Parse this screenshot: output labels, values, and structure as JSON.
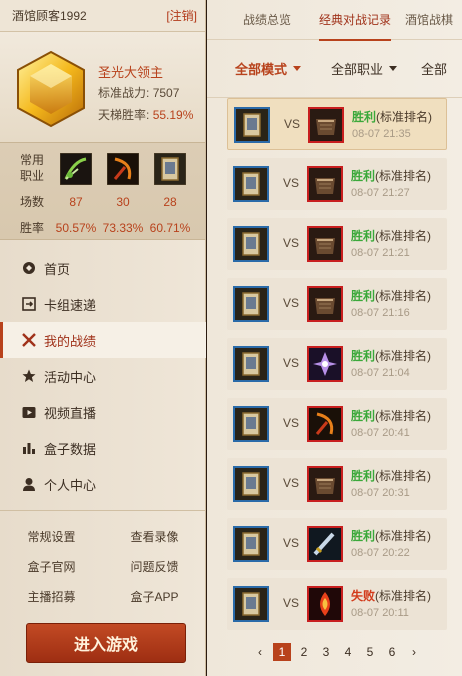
{
  "account": {
    "username": "酒馆顾客1992",
    "logout": "[注销]"
  },
  "profile": {
    "rank_name": "圣光大领主",
    "power_label": "标准战力:",
    "power_value": "7507",
    "ladder_label": "天梯胜率:",
    "ladder_value": "55.19%"
  },
  "stats": {
    "common_label": "常用",
    "class_label": "职业",
    "games_label": "场数",
    "winrate_label": "胜率",
    "classes": [
      {
        "icon": "hunter-bow-icon",
        "games": "87",
        "winrate": "50.57%"
      },
      {
        "icon": "rogue-weapon-icon",
        "games": "30",
        "winrate": "73.33%"
      },
      {
        "icon": "paladin-card-icon",
        "games": "28",
        "winrate": "60.71%"
      }
    ]
  },
  "nav": [
    {
      "label": "首页",
      "icon": "home-icon"
    },
    {
      "label": "卡组速递",
      "icon": "deck-icon"
    },
    {
      "label": "我的战绩",
      "icon": "swords-icon",
      "active": true
    },
    {
      "label": "活动中心",
      "icon": "star-icon"
    },
    {
      "label": "视频直播",
      "icon": "video-icon"
    },
    {
      "label": "盒子数据",
      "icon": "bar-chart-icon"
    },
    {
      "label": "个人中心",
      "icon": "user-icon"
    }
  ],
  "links": [
    [
      "常规设置",
      "查看录像"
    ],
    [
      "盒子官网",
      "问题反馈"
    ],
    [
      "主播招募",
      "盒子APP"
    ]
  ],
  "enter_game": "进入游戏",
  "tabs": [
    "战绩总览",
    "经典对战记录",
    "酒馆战棋"
  ],
  "filters": [
    "全部模式",
    "全部职业",
    "全部"
  ],
  "vs_label": "VS",
  "matches": [
    {
      "result": "胜利",
      "mode": "(标准排名)",
      "time": "08-07 21:35",
      "opp": "warrior"
    },
    {
      "result": "胜利",
      "mode": "(标准排名)",
      "time": "08-07 21:27",
      "opp": "warrior"
    },
    {
      "result": "胜利",
      "mode": "(标准排名)",
      "time": "08-07 21:21",
      "opp": "warrior"
    },
    {
      "result": "胜利",
      "mode": "(标准排名)",
      "time": "08-07 21:16",
      "opp": "warrior"
    },
    {
      "result": "胜利",
      "mode": "(标准排名)",
      "time": "08-07 21:04",
      "opp": "priest"
    },
    {
      "result": "胜利",
      "mode": "(标准排名)",
      "time": "08-07 20:41",
      "opp": "hunter"
    },
    {
      "result": "胜利",
      "mode": "(标准排名)",
      "time": "08-07 20:31",
      "opp": "warrior"
    },
    {
      "result": "胜利",
      "mode": "(标准排名)",
      "time": "08-07 20:22",
      "opp": "rogue"
    },
    {
      "result": "失败",
      "mode": "(标准排名)",
      "time": "08-07 20:11",
      "opp": "mage"
    }
  ],
  "pager": {
    "prev": "‹",
    "next": "›",
    "pages": [
      "1",
      "2",
      "3",
      "4",
      "5",
      "6"
    ],
    "current": "1"
  },
  "colors": {
    "accent": "#b8421c",
    "win": "#3aa83a",
    "lose": "#d23a1a",
    "player_frame": "#2a6aa8",
    "opponent_frame": "#c81e1e"
  }
}
